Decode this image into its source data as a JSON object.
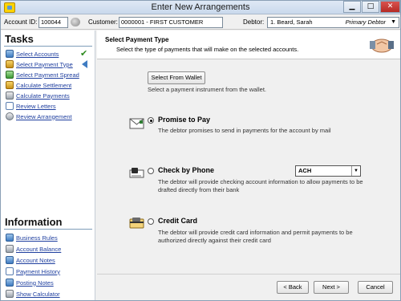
{
  "window": {
    "title": "Enter New Arrangements",
    "controls": {
      "minimize": "▁",
      "maximize": "□",
      "close": "✕"
    }
  },
  "account_bar": {
    "account_id_label": "Account ID:",
    "account_id": "100044",
    "customer_label": "Customer:",
    "customer": "0000001 - FIRST CUSTOMER",
    "debtor_label": "Debtor:",
    "debtor": "1. Beard, Sarah",
    "debtor_role": "Primary Debtor"
  },
  "tasks": {
    "title": "Tasks",
    "items": [
      {
        "label": "Select Accounts",
        "icon": "accounts-icon",
        "status": "completed"
      },
      {
        "label": "Select Payment Type",
        "icon": "payment-type-icon",
        "status": "current"
      },
      {
        "label": "Select Payment Spread",
        "icon": "spread-icon"
      },
      {
        "label": "Calculate Settlement",
        "icon": "settlement-icon"
      },
      {
        "label": "Calculate Payments",
        "icon": "calculator-icon"
      },
      {
        "label": "Review Letters",
        "icon": "letters-icon"
      },
      {
        "label": "Review Arrangement",
        "icon": "magnifier-icon"
      }
    ]
  },
  "information": {
    "title": "Information",
    "items": [
      {
        "label": "Business Rules",
        "icon": "rules-icon"
      },
      {
        "label": "Account Balance",
        "icon": "balance-icon"
      },
      {
        "label": "Account Notes",
        "icon": "notes-icon"
      },
      {
        "label": "Payment History",
        "icon": "history-icon"
      },
      {
        "label": "Posting Notes",
        "icon": "posting-icon"
      },
      {
        "label": "Show Calculator",
        "icon": "calculator-icon"
      }
    ]
  },
  "step": {
    "title": "Select Payment Type",
    "description": "Select the type of payments that will make on the selected accounts."
  },
  "wallet": {
    "button": "Select From Wallet",
    "description": "Select a payment instrument from the wallet."
  },
  "options": [
    {
      "label": "Promise to Pay",
      "selected": true,
      "description": "The debtor promises to send in payments for the account by mail"
    },
    {
      "label": "Check by Phone",
      "selected": false,
      "select_value": "ACH",
      "description": "The debtor will provide checking account information to allow payments to be drafted directly from their bank"
    },
    {
      "label": "Credit Card",
      "selected": false,
      "description": "The debtor will provide credit card information and permit payments to be authorized directly against their credit card"
    }
  ],
  "footer": {
    "back": "< Back",
    "next": "Next >",
    "cancel": "Cancel"
  }
}
